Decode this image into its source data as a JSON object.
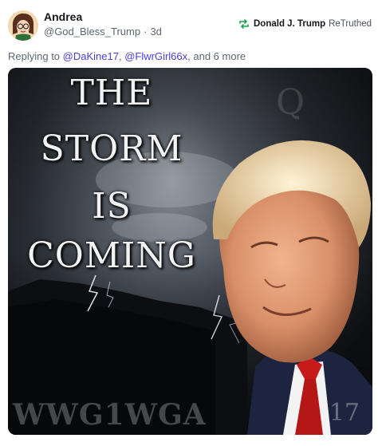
{
  "post": {
    "author_name": "Andrea",
    "author_handle": "@God_Bless_Trump",
    "separator": "·",
    "age": "3d",
    "retruthed_by": "Donald J. Trump",
    "retruth_label": "ReTruthed",
    "replying_prefix": "Replying to",
    "reply_to_1": "@DaKine17",
    "reply_sep": ",",
    "reply_to_2": "@FlwrGirl66x",
    "reply_suffix": ", and 6 more"
  },
  "media": {
    "line1": "THE",
    "line2": "STORM",
    "line3": "IS",
    "line4": "COMING",
    "watermark": "WWG1WGA",
    "corner_number": "17",
    "faint_letter": "Q"
  },
  "icons": {
    "retruth_icon": "retruth-arrows-icon",
    "retruth_color": "#16a34a",
    "link_color": "#4a3fd6"
  }
}
